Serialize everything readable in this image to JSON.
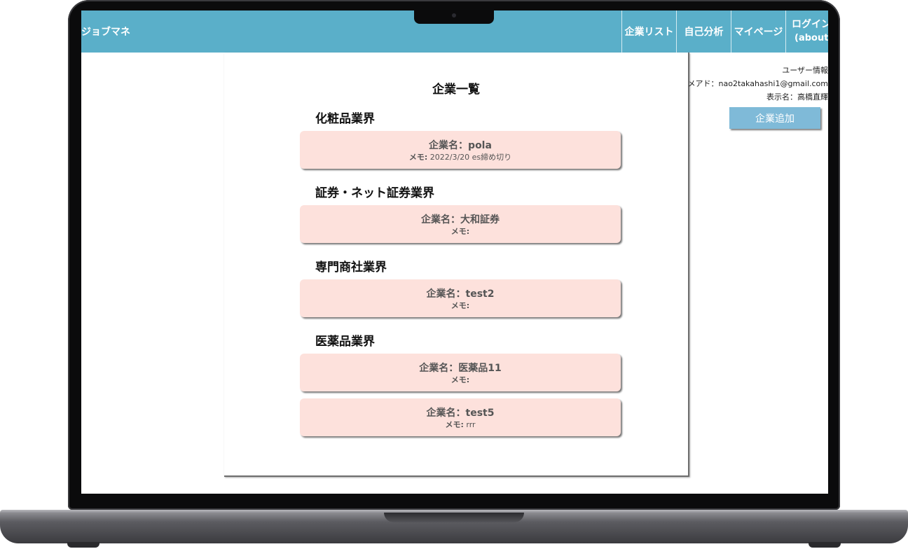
{
  "app": {
    "brand": "ジョブマネ",
    "nav": [
      {
        "label": "企業リスト"
      },
      {
        "label": "自己分析"
      },
      {
        "label": "マイページ"
      }
    ],
    "login": {
      "label": "ログイン",
      "sub": "(about)"
    }
  },
  "main": {
    "title": "企業一覧",
    "industries": [
      {
        "name": "化粧品業界",
        "companies": [
          {
            "name": "企業名：pola",
            "memo_label": "メモ:",
            "memo": "2022/3/20 es締め切り"
          }
        ]
      },
      {
        "name": "証券・ネット証券業界",
        "companies": [
          {
            "name": "企業名：大和証券",
            "memo_label": "メモ:",
            "memo": ""
          }
        ]
      },
      {
        "name": "専門商社業界",
        "companies": [
          {
            "name": "企業名：test2",
            "memo_label": "メモ:",
            "memo": ""
          }
        ]
      },
      {
        "name": "医薬品業界",
        "companies": [
          {
            "name": "企業名：医薬品11",
            "memo_label": "メモ:",
            "memo": ""
          },
          {
            "name": "企業名：test5",
            "memo_label": "メモ:",
            "memo": "rrr"
          }
        ]
      }
    ]
  },
  "user_panel": {
    "heading": "ユーザー情報",
    "email": "メアド：nao2takahashi1@gmail.com",
    "display_name": "表示名：高橋直輝",
    "add_button": "企業追加"
  },
  "colors": {
    "navbar": "#5aafc9",
    "card": "#fde1dc",
    "add_button": "#7fbad8"
  }
}
